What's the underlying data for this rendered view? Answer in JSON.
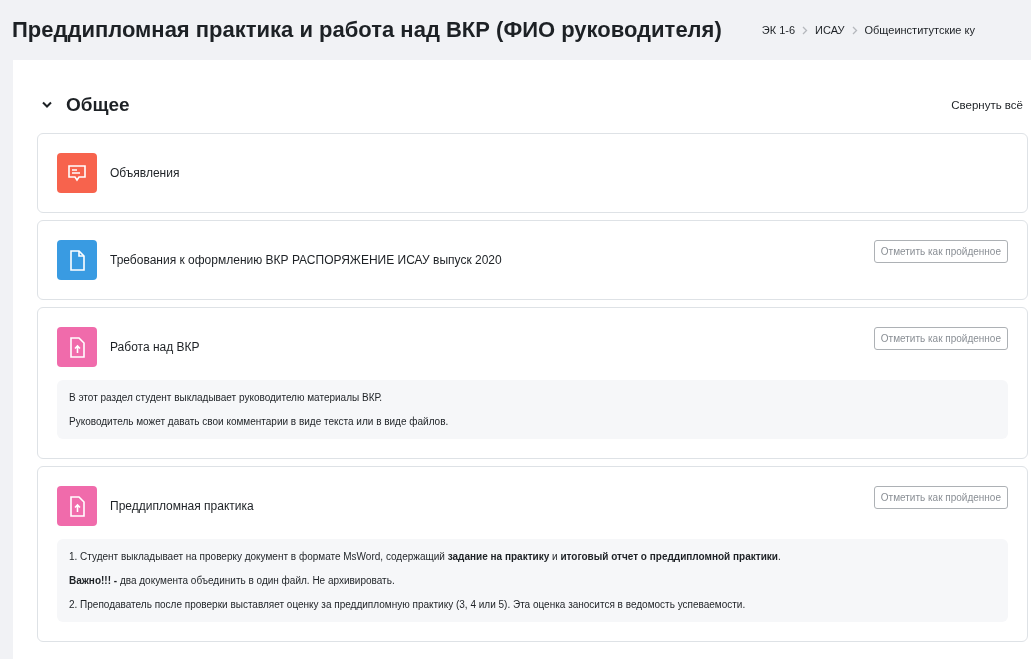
{
  "page_title": "Преддипломная практика и работа над ВКР (ФИО руководителя)",
  "breadcrumb": [
    "ЭК 1-6",
    "ИСАУ",
    "Общеинститутские ку"
  ],
  "section": {
    "title": "Общее",
    "expanded": true,
    "collapse_all": "Свернуть всё"
  },
  "activities": [
    {
      "kind": "announcement",
      "name": "Объявления"
    },
    {
      "kind": "file",
      "name": "Требования к оформлению ВКР РАСПОРЯЖЕНИЕ ИСАУ выпуск 2020",
      "completion_button": "Отметить как пройденное"
    },
    {
      "kind": "assignment",
      "name": "Работа над ВКР",
      "completion_button": "Отметить как пройденное",
      "description": [
        "В этот раздел студент выкладывает руководителю материалы ВКР.",
        "Руководитель может давать свои комментарии в виде текста или в виде файлов."
      ]
    },
    {
      "kind": "assignment",
      "name": "Преддипломная практика",
      "completion_button": "Отметить как пройденное",
      "description": [
        "1. Студент выкладывает на проверку документ в формате MsWord, содержащий **задание на практику** и **итоговый отчет о преддипломной практики**.",
        "**Важно!!! -** два документа объединить в один файл. Не архивировать.",
        "2. Преподаватель после проверки выставляет оценку за преддипломную практику (3, 4 или 5). Эта оценка заносится в ведомость успеваемости."
      ]
    }
  ]
}
